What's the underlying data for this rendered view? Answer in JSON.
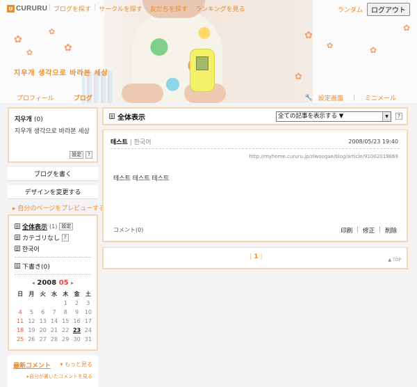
{
  "header": {
    "logo_mark": "U",
    "logo_text": "CURURU",
    "nav": [
      "ブログを探す",
      "サークルを探す",
      "友だちを探す",
      "ランキングを見る"
    ],
    "random": "ランダム",
    "logout": "ログアウト",
    "blog_title": "지우개 생각으로 바라본 세상",
    "profile_link": "プロフィール",
    "blog_link": "ブログ",
    "settings_link": "設定画面",
    "mini_mail": "ミニメール",
    "flower_glyph": "✿"
  },
  "sidebar": {
    "profile": {
      "name": "지우개",
      "count": "(0)",
      "desc": "지우개 생각으로 바라본 세상",
      "settings_btn": "設定",
      "help_btn": "?"
    },
    "write_blog": "ブログを書く",
    "change_design": "デザインを変更する",
    "preview": "▸ 自分のページをプレビューする",
    "categories": {
      "all": "全体表示",
      "all_count": "(1)",
      "settings_btn": "設定",
      "uncategorized": "カテゴリなし",
      "help_btn": "?",
      "korean": "한국어",
      "drafts": "下書き(0)"
    },
    "calendar": {
      "prev": "◂",
      "year": "2008",
      "month": "05",
      "next": "▸",
      "weekdays": [
        "日",
        "月",
        "火",
        "水",
        "木",
        "金",
        "土"
      ],
      "weeks": [
        [
          "",
          "",
          "",
          "",
          "1",
          "2",
          "3"
        ],
        [
          "4",
          "5",
          "6",
          "7",
          "8",
          "9",
          "10"
        ],
        [
          "11",
          "12",
          "13",
          "14",
          "15",
          "16",
          "17"
        ],
        [
          "18",
          "19",
          "20",
          "21",
          "22",
          "23",
          "24"
        ],
        [
          "25",
          "26",
          "27",
          "28",
          "29",
          "30",
          "31"
        ]
      ],
      "today": "23"
    },
    "comments": {
      "title": "最新コメント",
      "more": "▾ もっと見る",
      "mine": "▸自分が書いたコメントを見る"
    }
  },
  "main": {
    "title": "全体表示",
    "select_value": "全ての記事を表示する ▼",
    "help_btn": "?",
    "article": {
      "title": "테스트",
      "sep": "|",
      "category": "한국어",
      "date": "2008/05/23 19:40",
      "url": "http://myhome.cururu.jp/ziwoogae/blog/article/91002019869",
      "body": "테스트 테스트 테스트",
      "comments": "コメント(0)",
      "print": "印刷",
      "edit": "修正",
      "delete": "削除",
      "sep2": "|"
    },
    "pager": {
      "current": "1",
      "bar": "|",
      "to_top": "▲ TOP"
    }
  }
}
